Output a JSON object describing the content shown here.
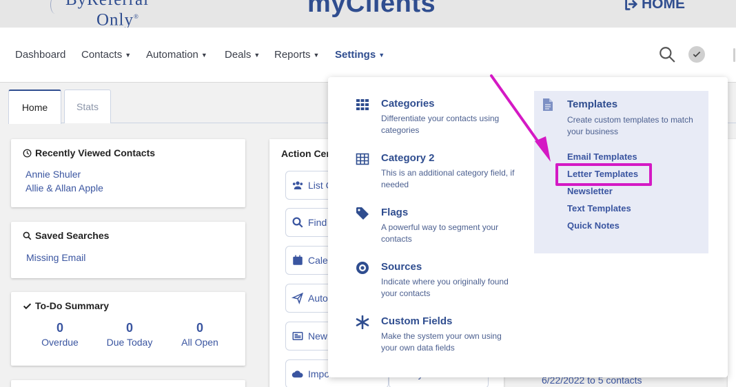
{
  "brand": {
    "logo_line1": "ByReferral",
    "logo_line2": "Only",
    "app_title": "myClients",
    "home_label": "HOME"
  },
  "nav": {
    "items": [
      {
        "label": "Dashboard",
        "caret": false
      },
      {
        "label": "Contacts",
        "caret": true
      },
      {
        "label": "Automation",
        "caret": true
      },
      {
        "label": "Deals",
        "caret": true
      },
      {
        "label": "Reports",
        "caret": true
      },
      {
        "label": "Settings",
        "caret": true,
        "active": true
      }
    ],
    "icons": [
      "search-icon",
      "check-icon"
    ]
  },
  "tabs": [
    {
      "label": "Home",
      "active": true
    },
    {
      "label": "Stats",
      "active": false
    }
  ],
  "recent": {
    "title": "Recently Viewed Contacts",
    "items": [
      "Annie Shuler",
      "Allie & Allan Apple"
    ]
  },
  "saved": {
    "title": "Saved Searches",
    "items": [
      "Missing Email"
    ]
  },
  "todo": {
    "title": "To-Do Summary",
    "cols": [
      {
        "value": "0",
        "label": "Overdue"
      },
      {
        "value": "0",
        "label": "Due Today"
      },
      {
        "value": "0",
        "label": "All Open"
      }
    ]
  },
  "action": {
    "title": "Action Center",
    "buttons": [
      "List C",
      "Find",
      "Cale",
      "Auto",
      "New",
      "Import Contacts",
      "My Account"
    ]
  },
  "settings_menu": {
    "items": [
      {
        "title": "Categories",
        "desc": "Differentiate your contacts using categories",
        "icon": "grid-icon"
      },
      {
        "title": "Category 2",
        "desc": "This is an additional category field, if needed",
        "icon": "table-icon"
      },
      {
        "title": "Flags",
        "desc": "A powerful way to segment your contacts",
        "icon": "tag-icon"
      },
      {
        "title": "Sources",
        "desc": "Indicate where you originally found your contacts",
        "icon": "target-icon"
      },
      {
        "title": "Custom Fields",
        "desc": "Make the system your own using your own data fields",
        "icon": "asterisk-icon"
      }
    ],
    "templates": {
      "title": "Templates",
      "desc": "Create custom templates to match your business",
      "links": [
        "Email Templates",
        "Letter Templates",
        "Newsletter",
        "Text Templates",
        "Quick Notes"
      ]
    }
  },
  "bottom_text": "6/22/2022 to 5 contacts",
  "colors": {
    "brand": "#2f4d8f",
    "link": "#3a55a0",
    "highlight": "#d419c4"
  }
}
